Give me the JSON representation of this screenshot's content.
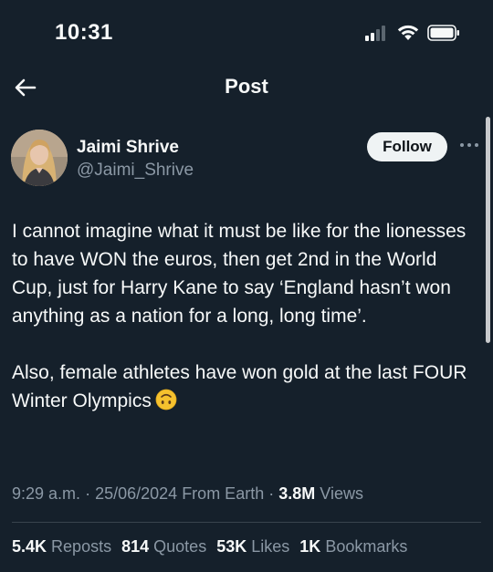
{
  "status_bar": {
    "time": "10:31"
  },
  "header": {
    "title": "Post"
  },
  "author": {
    "name": "Jaimi Shrive",
    "handle": "@Jaimi_Shrive",
    "follow_label": "Follow"
  },
  "post": {
    "paragraph_1": "I cannot imagine what it must be like for the lionesses to have WON the euros, then get 2nd in the World Cup, just for Harry Kane to say ‘England hasn’t won anything as a nation for a long, long time’.",
    "paragraph_2": "Also, female athletes have won gold at the last FOUR Winter Olympics",
    "emoji": "upside-down-face-icon"
  },
  "meta": {
    "time": "9:29 a.m.",
    "date": "25/06/2024",
    "location": "From Earth",
    "views_count": "3.8M",
    "views_label": "Views",
    "separator": "·"
  },
  "stats": {
    "reposts_count": "5.4K",
    "reposts_label": "Reposts",
    "quotes_count": "814",
    "quotes_label": "Quotes",
    "likes_count": "53K",
    "likes_label": "Likes",
    "bookmarks_count": "1K",
    "bookmarks_label": "Bookmarks"
  },
  "colors": {
    "background": "#15202b",
    "text_primary": "#f7f9f9",
    "text_secondary": "#8b98a5",
    "follow_bg": "#eff3f4",
    "divider": "#38444d"
  }
}
